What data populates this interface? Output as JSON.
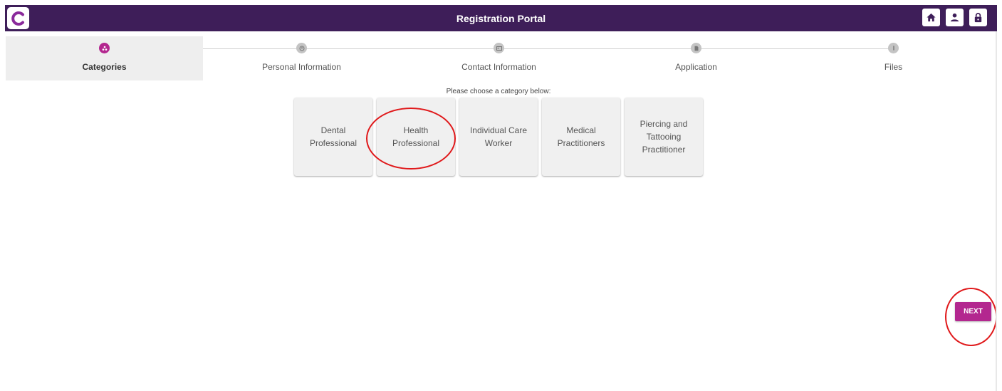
{
  "app": {
    "title": "Registration Portal",
    "logo_icon": "c-logo-icon",
    "brand_color": "#3e1e59",
    "accent_color": "#b3278f",
    "header_icons": [
      "home-icon",
      "user-icon",
      "lock-icon"
    ]
  },
  "stepper": {
    "steps": [
      {
        "label": "Categories",
        "icon": "categories-icon",
        "active": true
      },
      {
        "label": "Personal Information",
        "icon": "person-icon",
        "active": false
      },
      {
        "label": "Contact Information",
        "icon": "contact-card-icon",
        "active": false
      },
      {
        "label": "Application",
        "icon": "document-icon",
        "active": false
      },
      {
        "label": "Files",
        "icon": "attachment-icon",
        "active": false
      }
    ]
  },
  "categories": {
    "prompt": "Please choose a category below:",
    "items": [
      {
        "label": "Dental\nProfessional"
      },
      {
        "label": "Health\nProfessional"
      },
      {
        "label": "Individual Care\nWorker"
      },
      {
        "label": "Medical\nPractitioners"
      },
      {
        "label": "Piercing and\nTattooing\nPractitioner"
      }
    ]
  },
  "actions": {
    "next_label": "NEXT"
  }
}
